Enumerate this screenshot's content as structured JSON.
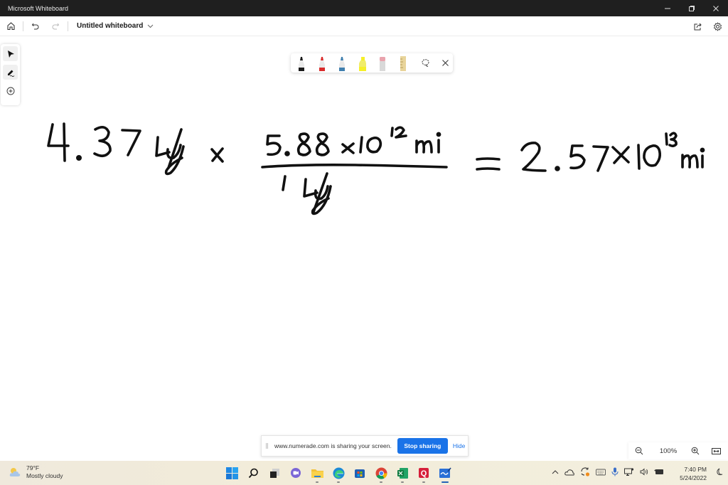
{
  "window": {
    "title": "Microsoft Whiteboard",
    "controls": [
      "minimize",
      "restore",
      "close"
    ]
  },
  "toolbar": {
    "home_icon": "home-icon",
    "undo_icon": "undo-icon",
    "redo_icon": "redo-icon",
    "board_title": "Untitled whiteboard",
    "share_icon": "share-icon",
    "settings_icon": "gear-icon"
  },
  "left_panel": {
    "tools": [
      {
        "name": "select",
        "icon": "pointer-icon",
        "active": true
      },
      {
        "name": "ink",
        "icon": "pen-icon",
        "active": false
      },
      {
        "name": "add",
        "icon": "plus-circle-icon",
        "active": false
      }
    ]
  },
  "pen_toolbar": {
    "pens": [
      {
        "name": "black-pen",
        "color": "#1a1a1a"
      },
      {
        "name": "red-pen",
        "color": "#d92b2b"
      },
      {
        "name": "blue-pen",
        "color": "#3f7fae"
      },
      {
        "name": "yellow-highlighter",
        "color": "#f5ef2a"
      },
      {
        "name": "eraser",
        "color": "#e9a3ad"
      },
      {
        "name": "ruler",
        "color": "#e8d49a"
      }
    ],
    "lasso_icon": "lasso-icon",
    "close_icon": "close-icon"
  },
  "canvas": {
    "ink_text": {
      "term1": "4.37 ly",
      "operator": "×",
      "numerator": "5.88 × 10^12 mi",
      "denominator": "1 ly",
      "equals": "=",
      "result": "2.57 × 10^13 mi"
    }
  },
  "share_bar": {
    "message": "www.numerade.com is sharing your screen.",
    "stop_label": "Stop sharing",
    "hide_label": "Hide"
  },
  "zoom": {
    "level": "100%"
  },
  "taskbar": {
    "weather": {
      "temp": "79°F",
      "condition": "Mostly cloudy"
    },
    "apps": [
      "start",
      "search",
      "task-view",
      "teams-chat",
      "file-explorer",
      "edge",
      "store",
      "chrome",
      "excel",
      "quizlet",
      "whiteboard"
    ],
    "time": "7:40 PM",
    "date": "5/24/2022"
  }
}
